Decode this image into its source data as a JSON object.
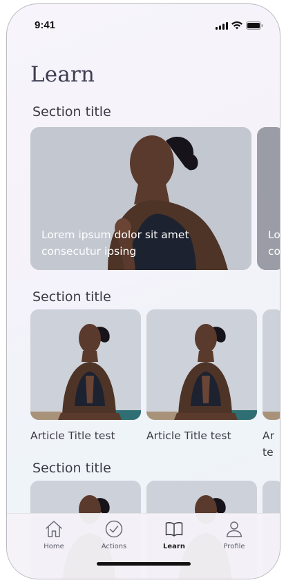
{
  "status_bar": {
    "time": "9:41"
  },
  "page": {
    "title": "Learn"
  },
  "sections": [
    {
      "title": "Section title",
      "cards": [
        {
          "caption": "Lorem ipsum dolor sit amet consecutur ipsing",
          "image": "woman-meditating-photo"
        },
        {
          "caption": "Lo co",
          "image": "woman-meditating-photo"
        }
      ]
    },
    {
      "title": "Section title",
      "articles": [
        {
          "title": "Article Title test",
          "image": "woman-meditating-photo"
        },
        {
          "title": "Article Title test",
          "image": "woman-meditating-photo"
        },
        {
          "title": "Ar te",
          "image": "woman-meditating-photo"
        }
      ]
    },
    {
      "title": "Section title",
      "articles": [
        {
          "image": "woman-meditating-photo"
        },
        {
          "image": "woman-meditating-photo"
        },
        {
          "image": "woman-meditating-photo"
        }
      ]
    }
  ],
  "tab_bar": {
    "items": [
      {
        "label": "Home",
        "icon": "home-icon"
      },
      {
        "label": "Actions",
        "icon": "check-circle-icon"
      },
      {
        "label": "Learn",
        "icon": "open-book-icon",
        "active": true
      },
      {
        "label": "Profile",
        "icon": "person-icon"
      }
    ]
  },
  "colors": {
    "title": "#3e3e52",
    "text": "#3b3b45",
    "active_tab": "#222222"
  }
}
